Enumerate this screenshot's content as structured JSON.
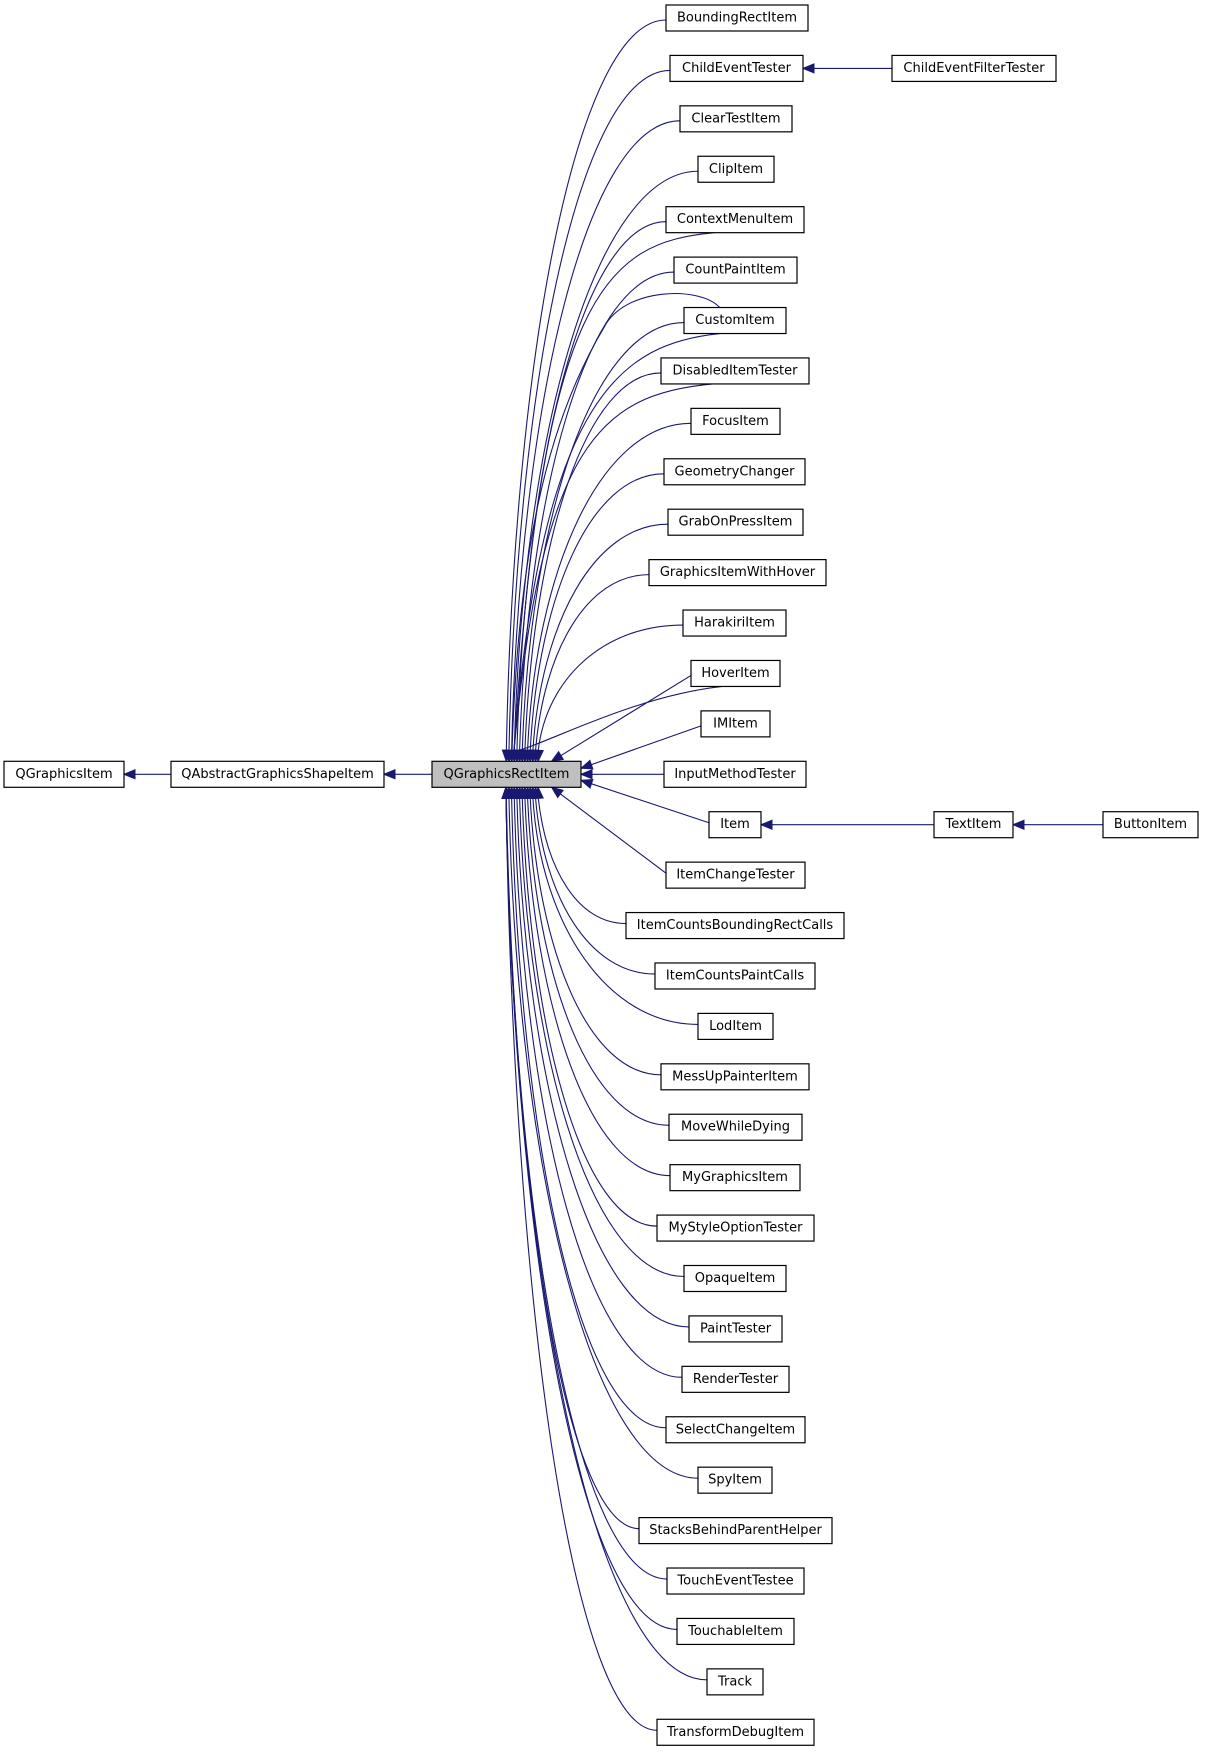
{
  "diagram": {
    "type": "inheritance-graph",
    "edge_color": "#191970",
    "highlight_fill": "#bfbfbf",
    "root": "QGraphicsItem",
    "focus": "QGraphicsRectItem",
    "nodes": [
      {
        "id": "QGraphicsItem",
        "label": "QGraphicsItem"
      },
      {
        "id": "QAbstractGraphicsShapeItem",
        "label": "QAbstractGraphicsShapeItem"
      },
      {
        "id": "QGraphicsRectItem",
        "label": "QGraphicsRectItem",
        "highlighted": true
      },
      {
        "id": "BoundingRectItem",
        "label": "BoundingRectItem"
      },
      {
        "id": "ChildEventTester",
        "label": "ChildEventTester"
      },
      {
        "id": "ClearTestItem",
        "label": "ClearTestItem"
      },
      {
        "id": "ClipItem",
        "label": "ClipItem"
      },
      {
        "id": "ContextMenuItem",
        "label": "ContextMenuItem"
      },
      {
        "id": "CountPaintItem",
        "label": "CountPaintItem"
      },
      {
        "id": "CustomItem",
        "label": "CustomItem"
      },
      {
        "id": "DisabledItemTester",
        "label": "DisabledItemTester"
      },
      {
        "id": "FocusItem",
        "label": "FocusItem"
      },
      {
        "id": "GeometryChanger",
        "label": "GeometryChanger"
      },
      {
        "id": "GrabOnPressItem",
        "label": "GrabOnPressItem"
      },
      {
        "id": "GraphicsItemWithHover",
        "label": "GraphicsItemWithHover"
      },
      {
        "id": "HarakiriItem",
        "label": "HarakiriItem"
      },
      {
        "id": "HoverItem",
        "label": "HoverItem"
      },
      {
        "id": "IMItem",
        "label": "IMItem"
      },
      {
        "id": "InputMethodTester",
        "label": "InputMethodTester"
      },
      {
        "id": "Item",
        "label": "Item"
      },
      {
        "id": "ItemChangeTester",
        "label": "ItemChangeTester"
      },
      {
        "id": "ItemCountsBoundingRectCalls",
        "label": "ItemCountsBoundingRectCalls"
      },
      {
        "id": "ItemCountsPaintCalls",
        "label": "ItemCountsPaintCalls"
      },
      {
        "id": "LodItem",
        "label": "LodItem"
      },
      {
        "id": "MessUpPainterItem",
        "label": "MessUpPainterItem"
      },
      {
        "id": "MoveWhileDying",
        "label": "MoveWhileDying"
      },
      {
        "id": "MyGraphicsItem",
        "label": "MyGraphicsItem"
      },
      {
        "id": "MyStyleOptionTester",
        "label": "MyStyleOptionTester"
      },
      {
        "id": "OpaqueItem",
        "label": "OpaqueItem"
      },
      {
        "id": "PaintTester",
        "label": "PaintTester"
      },
      {
        "id": "RenderTester",
        "label": "RenderTester"
      },
      {
        "id": "SelectChangeItem",
        "label": "SelectChangeItem"
      },
      {
        "id": "SpyItem",
        "label": "SpyItem"
      },
      {
        "id": "StacksBehindParentHelper",
        "label": "StacksBehindParentHelper"
      },
      {
        "id": "TouchEventTestee",
        "label": "TouchEventTestee"
      },
      {
        "id": "TouchableItem",
        "label": "TouchableItem"
      },
      {
        "id": "Track",
        "label": "Track"
      },
      {
        "id": "TransformDebugItem",
        "label": "TransformDebugItem"
      },
      {
        "id": "ChildEventFilterTester",
        "label": "ChildEventFilterTester"
      },
      {
        "id": "TextItem",
        "label": "TextItem"
      },
      {
        "id": "ButtonItem",
        "label": "ButtonItem"
      }
    ],
    "edges": [
      {
        "from": "QAbstractGraphicsShapeItem",
        "to": "QGraphicsItem"
      },
      {
        "from": "QGraphicsRectItem",
        "to": "QAbstractGraphicsShapeItem"
      },
      {
        "from": "BoundingRectItem",
        "to": "QGraphicsRectItem"
      },
      {
        "from": "ChildEventTester",
        "to": "QGraphicsRectItem"
      },
      {
        "from": "ClearTestItem",
        "to": "QGraphicsRectItem"
      },
      {
        "from": "ClipItem",
        "to": "QGraphicsRectItem"
      },
      {
        "from": "ContextMenuItem",
        "to": "QGraphicsRectItem"
      },
      {
        "from": "CountPaintItem",
        "to": "QGraphicsRectItem"
      },
      {
        "from": "CustomItem",
        "to": "QGraphicsRectItem"
      },
      {
        "from": "DisabledItemTester",
        "to": "QGraphicsRectItem"
      },
      {
        "from": "FocusItem",
        "to": "QGraphicsRectItem"
      },
      {
        "from": "GeometryChanger",
        "to": "QGraphicsRectItem"
      },
      {
        "from": "GrabOnPressItem",
        "to": "QGraphicsRectItem"
      },
      {
        "from": "GraphicsItemWithHover",
        "to": "QGraphicsRectItem"
      },
      {
        "from": "HarakiriItem",
        "to": "QGraphicsRectItem"
      },
      {
        "from": "HoverItem",
        "to": "QGraphicsRectItem"
      },
      {
        "from": "IMItem",
        "to": "QGraphicsRectItem"
      },
      {
        "from": "InputMethodTester",
        "to": "QGraphicsRectItem"
      },
      {
        "from": "Item",
        "to": "QGraphicsRectItem"
      },
      {
        "from": "ItemChangeTester",
        "to": "QGraphicsRectItem"
      },
      {
        "from": "ItemCountsBoundingRectCalls",
        "to": "QGraphicsRectItem"
      },
      {
        "from": "ItemCountsPaintCalls",
        "to": "QGraphicsRectItem"
      },
      {
        "from": "LodItem",
        "to": "QGraphicsRectItem"
      },
      {
        "from": "MessUpPainterItem",
        "to": "QGraphicsRectItem"
      },
      {
        "from": "MoveWhileDying",
        "to": "QGraphicsRectItem"
      },
      {
        "from": "MyGraphicsItem",
        "to": "QGraphicsRectItem"
      },
      {
        "from": "MyStyleOptionTester",
        "to": "QGraphicsRectItem"
      },
      {
        "from": "OpaqueItem",
        "to": "QGraphicsRectItem"
      },
      {
        "from": "PaintTester",
        "to": "QGraphicsRectItem"
      },
      {
        "from": "RenderTester",
        "to": "QGraphicsRectItem"
      },
      {
        "from": "SelectChangeItem",
        "to": "QGraphicsRectItem"
      },
      {
        "from": "SpyItem",
        "to": "QGraphicsRectItem"
      },
      {
        "from": "StacksBehindParentHelper",
        "to": "QGraphicsRectItem"
      },
      {
        "from": "TouchEventTestee",
        "to": "QGraphicsRectItem"
      },
      {
        "from": "TouchableItem",
        "to": "QGraphicsRectItem"
      },
      {
        "from": "Track",
        "to": "QGraphicsRectItem"
      },
      {
        "from": "TransformDebugItem",
        "to": "QGraphicsRectItem"
      },
      {
        "from": "ChildEventFilterTester",
        "to": "ChildEventTester"
      },
      {
        "from": "TextItem",
        "to": "Item"
      },
      {
        "from": "ButtonItem",
        "to": "TextItem"
      }
    ]
  }
}
